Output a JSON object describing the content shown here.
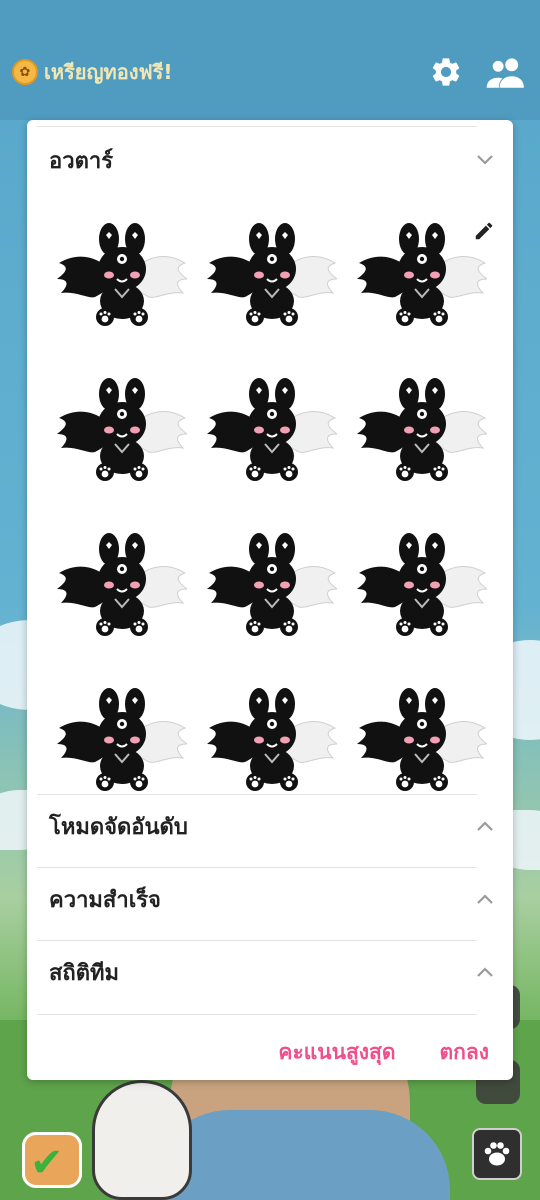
{
  "header": {
    "coin_label": "เหรียญทองฟรี!",
    "coin_icon": "coin-paw-icon",
    "settings_icon": "gear-icon",
    "friends_icon": "friends-icon"
  },
  "panel": {
    "sections": [
      {
        "title": "อวตาร์",
        "state": "expanded"
      },
      {
        "title": "โหมดจัดอันดับ",
        "state": "collapsed"
      },
      {
        "title": "ความสำเร็จ",
        "state": "collapsed"
      },
      {
        "title": "สถิติทีม",
        "state": "collapsed"
      }
    ],
    "avatar_count": 12,
    "footer": {
      "high_score_label": "คะแนนสูงสุด",
      "ok_label": "ตกลง"
    }
  },
  "colors": {
    "accent": "#ef4f8a",
    "coin_text": "#f2e7b3",
    "panel_bg": "#ffffff"
  }
}
